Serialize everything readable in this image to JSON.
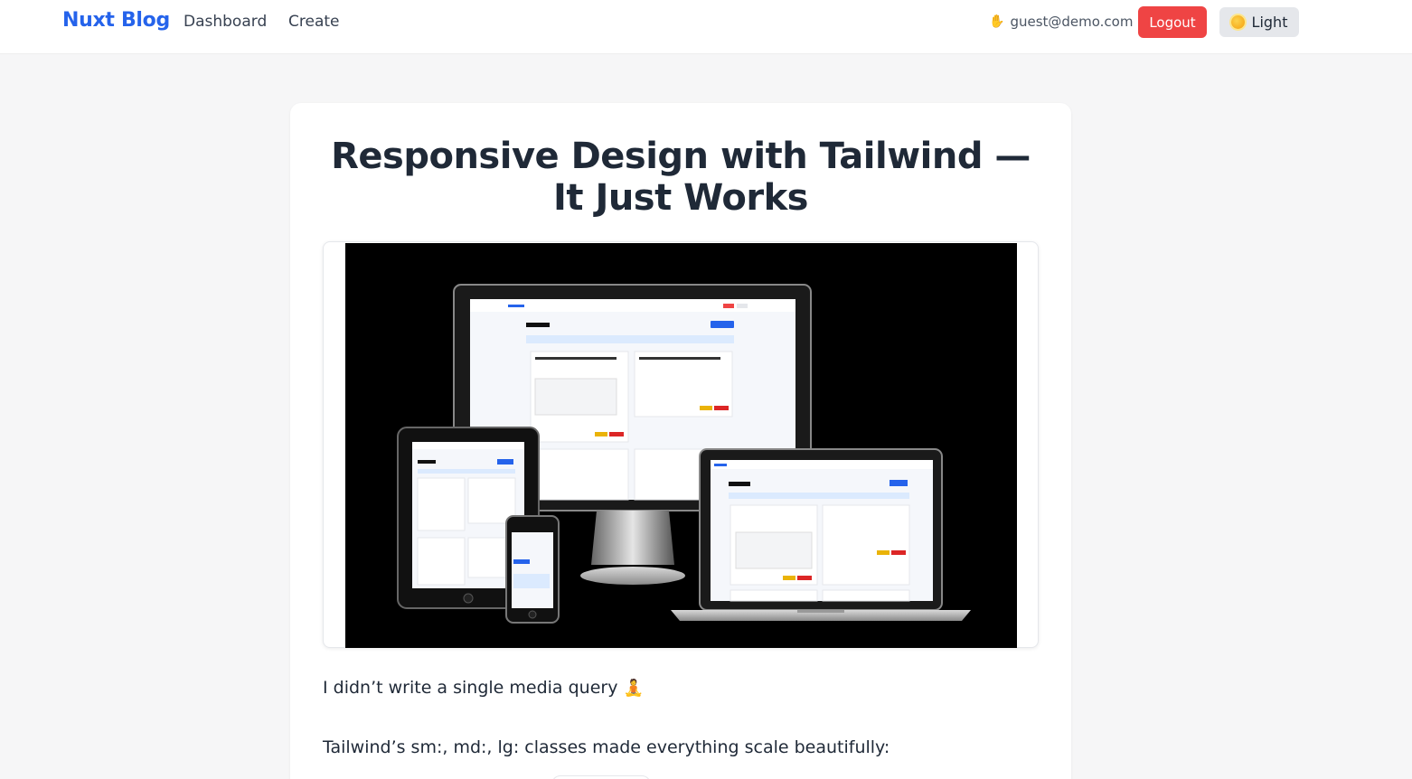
{
  "header": {
    "brand": "Nuxt Blog",
    "nav": {
      "dashboard": "Dashboard",
      "create": "Create"
    },
    "user_email": "guest@demo.com",
    "logout_label": "Logout",
    "theme_label": "Light",
    "user_icon": "waving-hand-icon",
    "theme_icon": "sun-icon"
  },
  "post": {
    "title": "Responsive Design with Tailwind — It Just Works",
    "paragraph_1": "I didn’t write a single media query",
    "paragraph_1_icon": "person-meditating-icon",
    "paragraph_2": "Tailwind’s sm:, md:, lg: classes made everything scale beautifully:"
  },
  "colors": {
    "brand": "#2563eb",
    "logout_bg": "#ef4444",
    "theme_btn_bg": "#e5e7eb",
    "page_bg": "#f6f6f7",
    "card_bg": "#ffffff"
  }
}
